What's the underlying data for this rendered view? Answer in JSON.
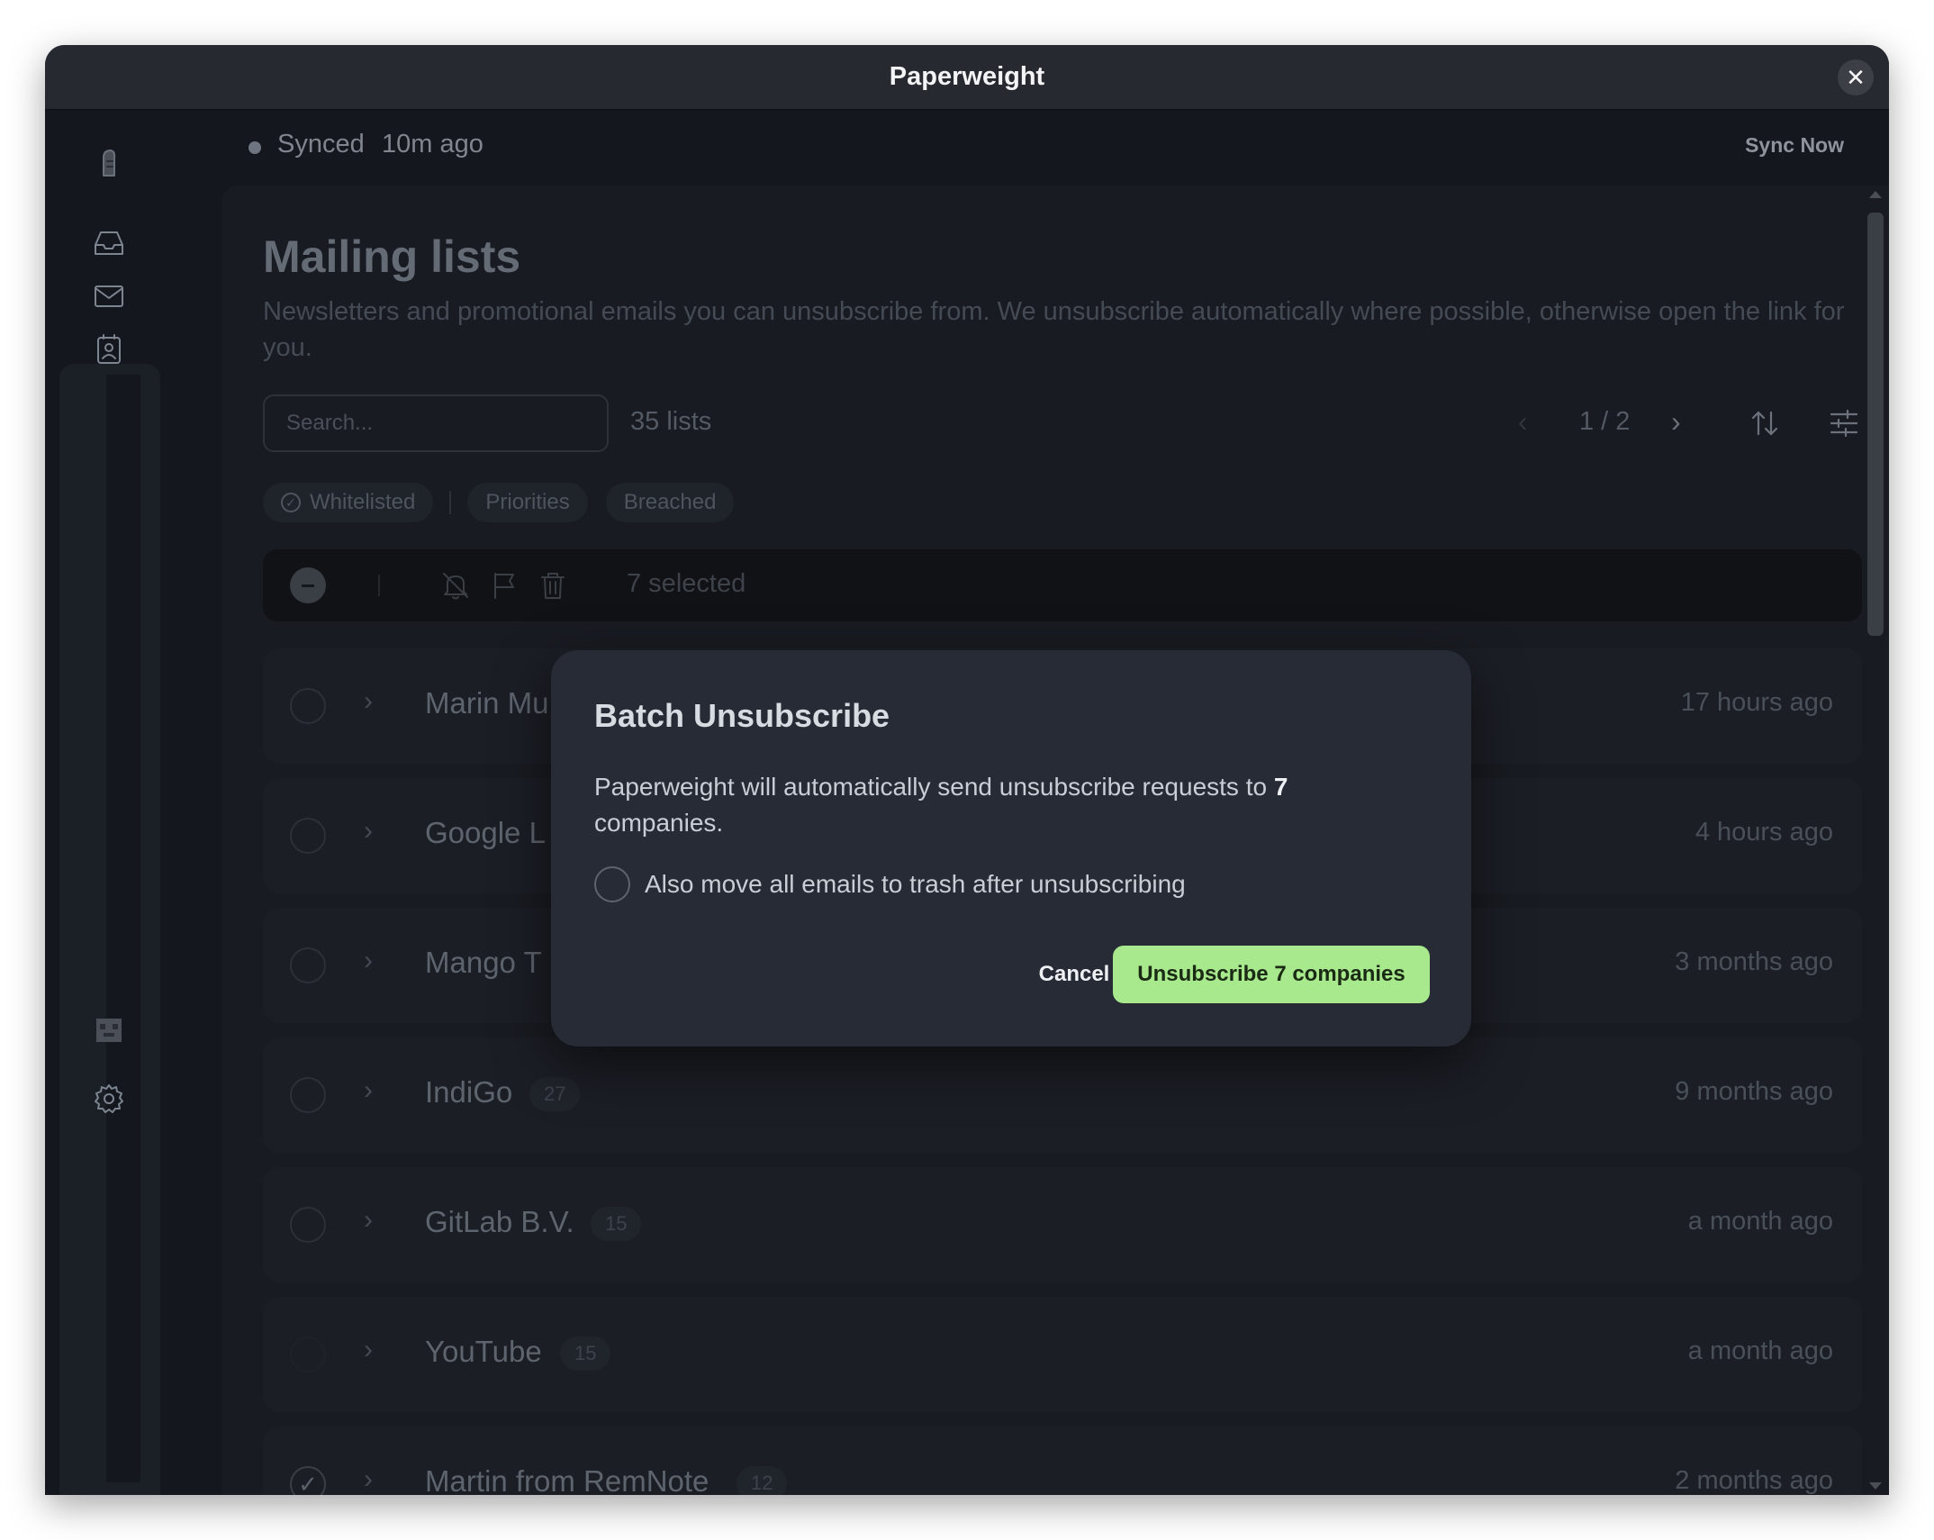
{
  "window": {
    "title": "Paperweight",
    "close_icon": "close-icon"
  },
  "sidebar": {
    "items": [
      {
        "name": "logo",
        "icon": "moai-logo-icon"
      },
      {
        "name": "inbox",
        "icon": "inbox-icon"
      },
      {
        "name": "mailing-lists",
        "icon": "mail-icon"
      },
      {
        "name": "contacts",
        "icon": "contact-icon"
      },
      {
        "name": "avatar",
        "icon": "pixel-avatar-icon"
      },
      {
        "name": "settings",
        "icon": "gear-icon"
      }
    ]
  },
  "status": {
    "label": "Synced",
    "time": "10m ago",
    "sync_now": "Sync Now"
  },
  "page": {
    "title": "Mailing lists",
    "description": "Newsletters and promotional emails you can unsubscribe from. We unsubscribe automatically where possible, otherwise open the link for you."
  },
  "toolbar": {
    "search_placeholder": "Search...",
    "list_count": "35 lists",
    "pager": "1 / 2",
    "prev_icon": "chevron-left-icon",
    "next_icon": "chevron-right-icon",
    "sort_icon": "sort-icon",
    "filter_icon": "filter-sliders-icon"
  },
  "chips": [
    {
      "label": "Whitelisted",
      "icon": "check-circle-icon"
    },
    {
      "label": "Priorities"
    },
    {
      "label": "Breached"
    }
  ],
  "batch": {
    "selected": "7 selected"
  },
  "rows": [
    {
      "name": "Marin Mu",
      "count": "",
      "time": "17 hours ago",
      "checked": false
    },
    {
      "name": "Google L",
      "count": "",
      "time": "4 hours ago",
      "checked": false
    },
    {
      "name": "Mango T",
      "count": "",
      "time": "3 months ago",
      "checked": false
    },
    {
      "name": "IndiGo",
      "count": "27",
      "time": "9 months ago",
      "checked": false
    },
    {
      "name": "GitLab B.V.",
      "count": "15",
      "time": "a month ago",
      "checked": false
    },
    {
      "name": "YouTube",
      "count": "15",
      "time": "a month ago",
      "checked": false
    },
    {
      "name": "Martin from RemNote",
      "count": "12",
      "time": "2 months ago",
      "checked": true
    }
  ],
  "modal": {
    "title": "Batch Unsubscribe",
    "text_before": "Paperweight will automatically send unsubscribe requests to ",
    "text_count": "7",
    "text_after": " companies.",
    "option": "Also move all emails to trash after unsubscribing",
    "cancel": "Cancel",
    "confirm": "Unsubscribe 7 companies"
  },
  "colors": {
    "accent": "#a7e98c",
    "background": "#14171d",
    "modal": "#262b35"
  }
}
